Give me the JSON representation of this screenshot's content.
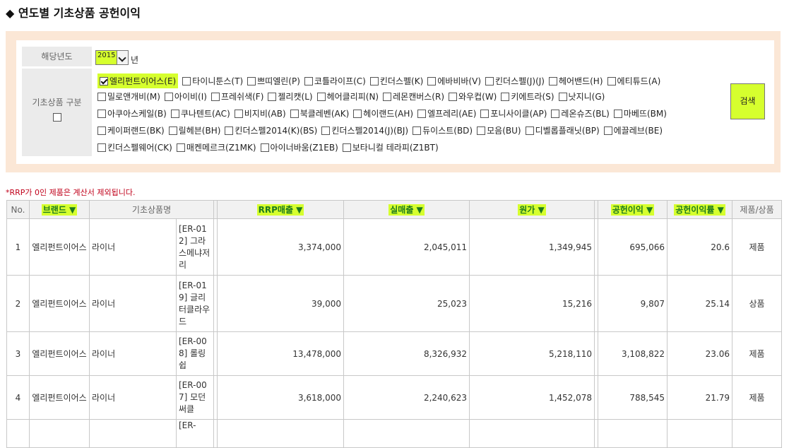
{
  "page": {
    "title": "◆ 연도별 기초상품 공헌이익"
  },
  "filter": {
    "year_label": "해당년도",
    "year_value": "2015",
    "year_unit": "년",
    "category_label": "기초상품 구분",
    "categories": [
      [
        "엘리펀트이어스(E)",
        "타이니툰스(T)",
        "쁘띠엘린(P)",
        "코틀라이프(C)",
        "킨더스펠(K)",
        "에바비바(V)",
        "킨더스펠(J)(J)",
        "헤어밴드(H)",
        "에티튜드(A)"
      ],
      [
        "밀로앤개비(M)",
        "아이비(I)",
        "프레쉬색(F)",
        "젤리캣(L)",
        "헤어클리피(N)",
        "레몬캔버스(R)",
        "와우컵(W)",
        "키에트라(S)",
        "낫지니(G)"
      ],
      [
        "아쿠아스케일(B)",
        "쿠나텐트(AC)",
        "비지비(AB)",
        "북클레벤(AK)",
        "헤이랜드(AH)",
        "엘프레리(AE)",
        "포니사이클(AP)",
        "레온슈즈(BL)",
        "마베뜨(BM)"
      ],
      [
        "케이퍼랜드(BK)",
        "릴헤븐(BH)",
        "킨더스펠2014(K)(BS)",
        "킨더스펠2014(J)(BJ)",
        "듀이스트(BD)",
        "모음(BU)",
        "디벨롭플래닛(BP)",
        "에끌레브(BE)"
      ],
      [
        "킨더스펠웨어(CK)",
        "매켄메르크(Z1MK)",
        "아이너바움(Z1EB)",
        "보타니컬 테라피(Z1BT)"
      ]
    ],
    "search_button": "검색",
    "colors": {
      "highlight": "#d6ff2e",
      "panel_bg": "#fbe7d6"
    }
  },
  "notice": "*RRP가 0인 제품은 계산서 제외됩니다.",
  "table": {
    "headers": {
      "no": "No.",
      "brand": "브랜드 ▼",
      "product_name": "기초상품명",
      "rrp_sales": "RRP매출 ▼",
      "actual_sales": "실매출 ▼",
      "cost": "원가 ▼",
      "contribution": "공헌이익 ▼",
      "contribution_rate": "공헌이익률 ▼",
      "type": "제품/상품"
    },
    "rows": [
      {
        "no": "1",
        "brand": "엘리펀트이어스",
        "category": "라이너",
        "name": "[ER-012] 그라스메냐저리",
        "rrp": "3,374,000",
        "actual": "2,045,011",
        "cost": "1,349,945",
        "contribution": "695,066",
        "rate": "20.6",
        "type": "제품"
      },
      {
        "no": "2",
        "brand": "엘리펀트이어스",
        "category": "라이너",
        "name": "[ER-019] 글리터클라우드",
        "rrp": "39,000",
        "actual": "25,023",
        "cost": "15,216",
        "contribution": "9,807",
        "rate": "25.14",
        "type": "상품"
      },
      {
        "no": "3",
        "brand": "엘리펀트이어스",
        "category": "라이너",
        "name": "[ER-008] 롤링쉽",
        "rrp": "13,478,000",
        "actual": "8,326,932",
        "cost": "5,218,110",
        "contribution": "3,108,822",
        "rate": "23.06",
        "type": "제품"
      },
      {
        "no": "4",
        "brand": "엘리펀트이어스",
        "category": "라이너",
        "name": "[ER-007] 모던써클",
        "rrp": "3,618,000",
        "actual": "2,240,623",
        "cost": "1,452,078",
        "contribution": "788,545",
        "rate": "21.79",
        "type": "제품"
      },
      {
        "no": "",
        "brand": "",
        "category": "",
        "name": "[ER-",
        "rrp": "",
        "actual": "",
        "cost": "",
        "contribution": "",
        "rate": "",
        "type": ""
      }
    ]
  }
}
